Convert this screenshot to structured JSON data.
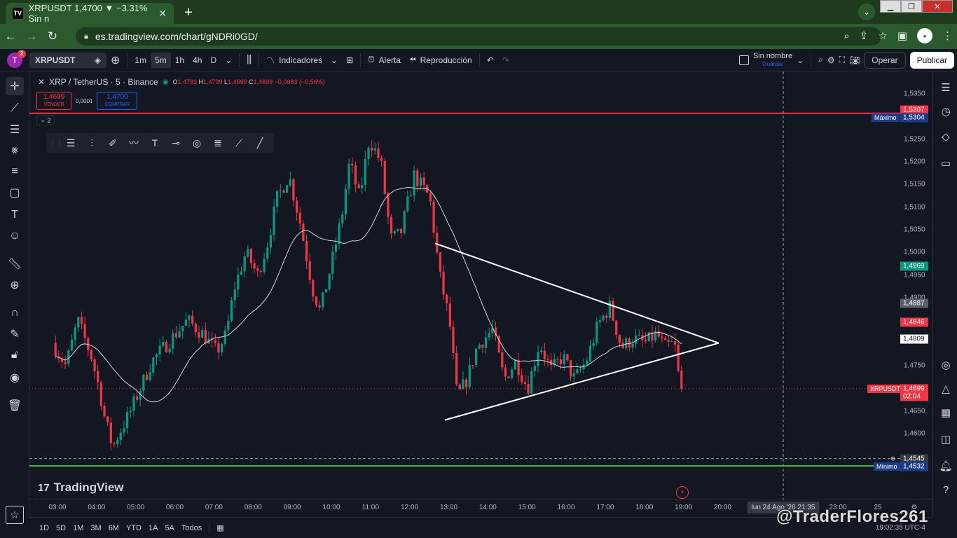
{
  "browser": {
    "tab_title": "XRPUSDT 1,4700 ▼ −3.31% Sin n",
    "favicon_text": "TV",
    "url": "es.tradingview.com/chart/gNDRi0GD/"
  },
  "toolbar": {
    "avatar_letter": "T",
    "notif_count": "2",
    "symbol": "XRPUSDT",
    "timeframes": [
      "1m",
      "5m",
      "1h",
      "4h",
      "D"
    ],
    "active_timeframe": "5m",
    "indicators": "Indicadores",
    "alert": "Alerta",
    "replay": "Reproducción",
    "layout_name": "Sin nombre",
    "layout_save": "Guardar",
    "trade": "Operar",
    "publish": "Publicar"
  },
  "legend": {
    "title": "XRP / TetherUS · 5 · Binance",
    "o_label": "O",
    "o": "1,4783",
    "h_label": "H",
    "h": "1,4799",
    "l_label": "L",
    "l": "1,4690",
    "c_label": "C",
    "c": "1,4699",
    "change": "−0,0083 (−0,56%)"
  },
  "trade": {
    "sell_price": "1,4699",
    "sell_label": "VENDER",
    "spread": "0,0001",
    "buy_price": "1,4700",
    "buy_label": "COMPRAR"
  },
  "collapse_count": "2",
  "chart_data": {
    "type": "candlestick",
    "symbol": "XRPUSDT",
    "interval": "5",
    "y_ticks": [
      "1,5350",
      "1,5300",
      "1,5250",
      "1,5200",
      "1,5150",
      "1,5100",
      "1,5050",
      "1,5000",
      "1,4950",
      "1,4900",
      "1,4750",
      "1,4650",
      "1,4600"
    ],
    "x_ticks": [
      "03:00",
      "04:00",
      "05:00",
      "06:00",
      "07:00",
      "08:00",
      "09:00",
      "10:00",
      "11:00",
      "12:00",
      "13:00",
      "14:00",
      "15:00",
      "16:00",
      "17:00",
      "18:00",
      "19:00",
      "20:00",
      "23:00",
      "25"
    ],
    "ylim": [
      1.452,
      1.537
    ],
    "max_price": 1.5307,
    "max_label": "Máximo",
    "max_value": "1,5304",
    "max_tag": "1,5307",
    "min_price": 1.4532,
    "min_label": "Mínimo",
    "min_value": "1,4532",
    "crosshair_price": "1,4545",
    "last_price_label": "XRPUSDT",
    "last_price": "1,4699",
    "countdown": "02:04",
    "price_tags": [
      {
        "value": "1,4969",
        "price": 1.4969,
        "color": "#089981"
      },
      {
        "value": "1,4887",
        "price": 1.4887,
        "color": "#5d606b"
      },
      {
        "value": "1,4846",
        "price": 1.4846,
        "color": "#f23645"
      },
      {
        "value": "1,4809",
        "price": 1.4809,
        "color": "#ffffff"
      }
    ],
    "crosshair_date": "lun 24 Ago '26   21:35",
    "colors": {
      "up": "#089981",
      "down": "#f23645",
      "ma": "#d1d4dc",
      "resistance": "#f23645",
      "support": "#4caf50",
      "triangle": "#ffffff"
    },
    "grid": false
  },
  "brand": "TradingView",
  "ranges": [
    "1D",
    "5D",
    "1M",
    "3M",
    "6M",
    "YTD",
    "1A",
    "5A",
    "Todos"
  ],
  "clock": "19:02:35 UTC-4",
  "watermark": "@TraderFlores261"
}
